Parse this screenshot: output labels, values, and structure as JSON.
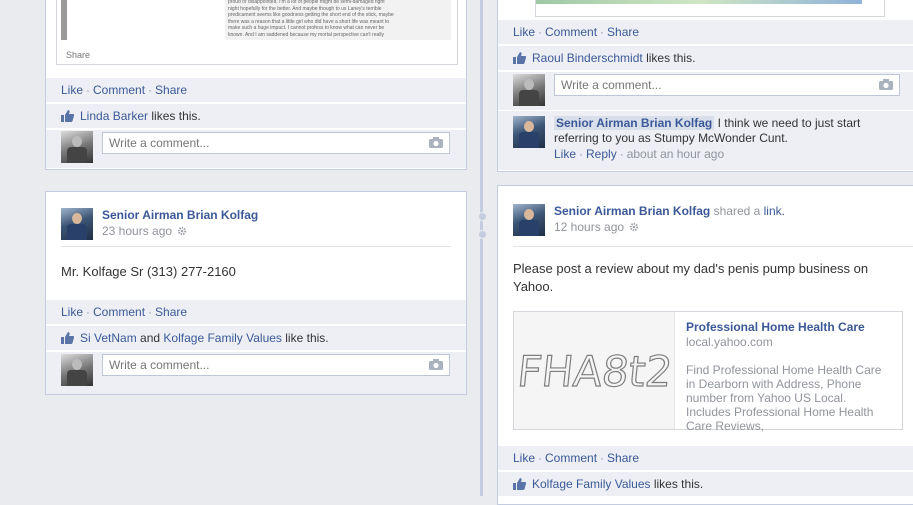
{
  "actions": {
    "like": "Like",
    "comment": "Comment",
    "share": "Share",
    "reply": "Reply"
  },
  "comment_placeholder": "Write a comment...",
  "top_left": {
    "article_share": "Share",
    "article_text_lines": [
      "proud or disappointed. I'm a lot of people might be semi-damaged right",
      "night hopefully for the better. And maybe though to us Laney's terrible",
      "predicament seems like goodness getting the short end of the stick, maybe",
      "there was a reason that a little girl who did have a short life was meant to",
      "make such a huge impact. I cannot profess to know what can never be",
      "known. And I am saddened because my mortal perspective can't really"
    ],
    "liker": "Linda Barker",
    "likes_suffix": "likes this."
  },
  "left_post": {
    "author": "Senior Airman Brian Kolfag",
    "time": "23 hours ago",
    "body": "Mr. Kolfage Sr (313) 277-2160",
    "liker1": "Si VetNam",
    "and": "and",
    "liker2": "Kolfage Family Values",
    "likes_suffix": "like this."
  },
  "top_right": {
    "liker": "Raoul Binderschmidt",
    "likes_suffix": "likes this.",
    "comment": {
      "author": "Senior Airman Brian Kolfag",
      "text": "I think we need to just start referring to you as Stumpy McWonder Cunt.",
      "time": "about an hour ago"
    }
  },
  "right_post": {
    "author": "Senior Airman Brian Kolfag",
    "shared": "shared a",
    "link_word": "link.",
    "time": "12 hours ago",
    "body": "Please post a review about my dad's penis pump business on Yahoo.",
    "link_card": {
      "title": "Professional Home Health Care",
      "domain": "local.yahoo.com",
      "description": "Find Professional Home Health Care in Dearborn with Address, Phone number from Yahoo US Local. Includes Professional Home Health Care Reviews,",
      "thumb_text": "FHA8t2"
    },
    "liker": "Kolfage Family Values",
    "likes_suffix": "likes this."
  }
}
